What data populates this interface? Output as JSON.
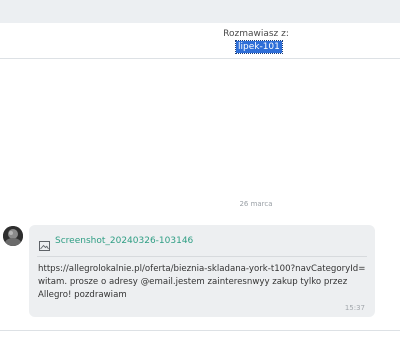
{
  "header": {
    "talk_label": "Rozmawiasz z:",
    "username": "lipek-101"
  },
  "conversation": {
    "date_separator": "26 marca",
    "message": {
      "attachment_name": "Screenshot_20240326-103146",
      "text": "https://allegrolokalnie.pl/oferta/bieznia-skladana-york-t100?navCategoryId= witam. prosze o adresy @email.jestem zainteresnwyy zakup tylko przez Allegro! pozdrawiam",
      "time": "15:37"
    }
  },
  "colors": {
    "accent_link": "#2f9e84",
    "selection": "#2f6fd8",
    "bubble": "#edeff1"
  }
}
